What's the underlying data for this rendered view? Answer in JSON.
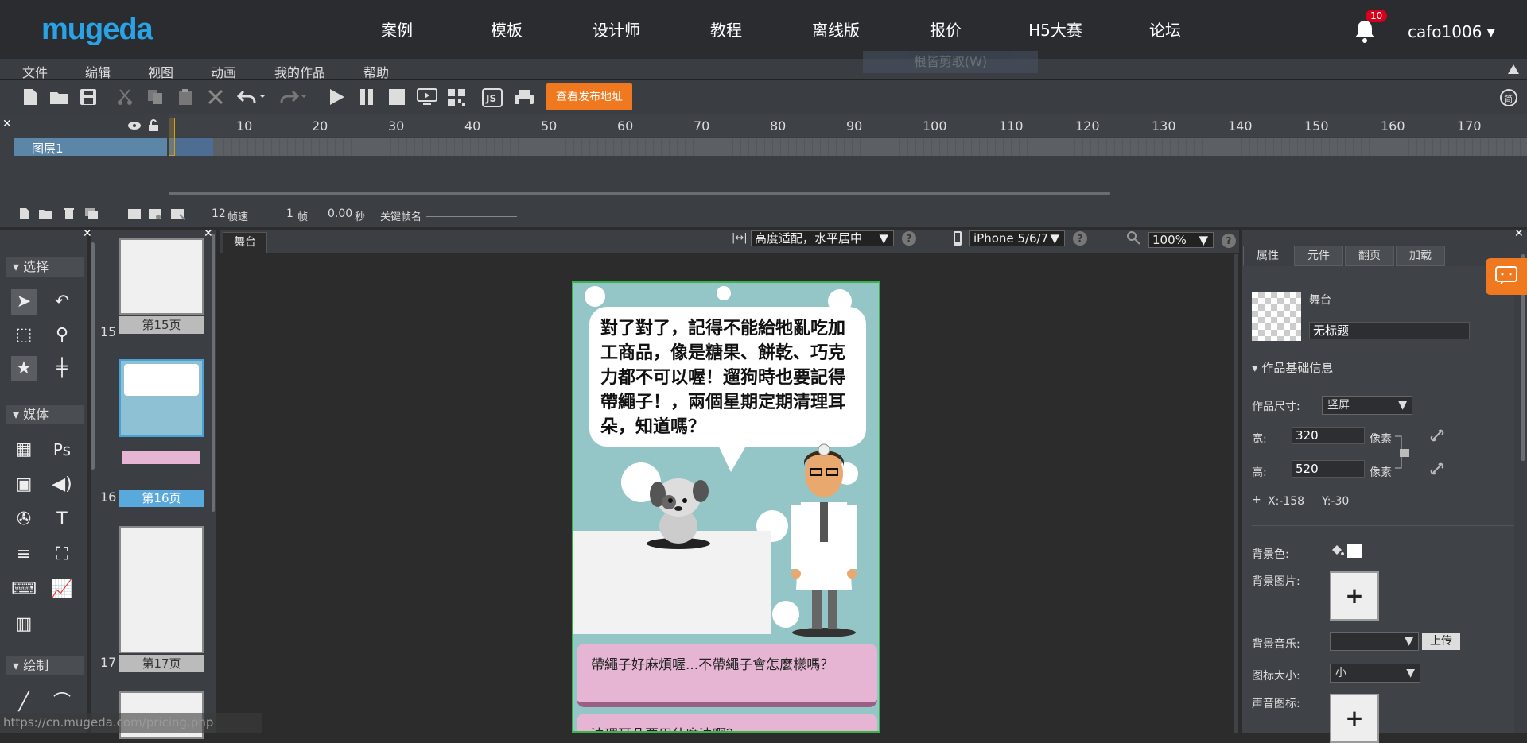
{
  "topnav": {
    "logo": "mugeda",
    "items": [
      "案例",
      "模板",
      "设计师",
      "教程",
      "离线版",
      "报价",
      "H5大赛",
      "论坛"
    ],
    "notification_count": "10",
    "username": "cafo1006 ▾"
  },
  "menubar": {
    "items": [
      "文件",
      "编辑",
      "视图",
      "动画",
      "我的作品",
      "帮助"
    ],
    "ghost_tooltip": "根皆剪取(W)"
  },
  "toolbar": {
    "publish_button": "查看发布地址"
  },
  "timeline": {
    "ruler_ticks": [
      "10",
      "20",
      "30",
      "40",
      "50",
      "60",
      "70",
      "80",
      "90",
      "100",
      "110",
      "120",
      "130",
      "140",
      "150",
      "160",
      "170"
    ],
    "layer_name": "图层1",
    "fps_value": "12",
    "fps_unit": "帧速",
    "frame_value": "1",
    "frame_unit": "帧",
    "time_value": "0.00",
    "time_unit": "秒",
    "keyframe_label": "关键帧名"
  },
  "tools": {
    "sections": [
      "选择",
      "媒体",
      "绘制"
    ]
  },
  "pages": [
    {
      "num": "15",
      "label": "第15页"
    },
    {
      "num": "16",
      "label": "第16页"
    },
    {
      "num": "17",
      "label": "第17页"
    }
  ],
  "stage": {
    "tab": "舞台",
    "fit_mode": "高度适配，水平居中",
    "device": "iPhone 5/6/7",
    "zoom": "100%",
    "bubble_text": "對了對了，記得不能給牠亂吃加工商品，像是糖果、餅乾、巧克力都不可以喔！遛狗時也要記得帶繩子！，兩個星期定期清理耳朵，知道嗎？",
    "choice1": "帶繩子好麻煩喔...不帶繩子會怎麼樣嗎？",
    "choice2": "清理耳朵要用什麼清啊？"
  },
  "properties": {
    "tabs": [
      "属性",
      "元件",
      "翻页",
      "加载"
    ],
    "object_type": "舞台",
    "title_value": "无标题",
    "section_basic": "作品基础信息",
    "size_label": "作品尺寸:",
    "size_value": "竖屏",
    "width_label": "宽:",
    "width_value": "320",
    "height_label": "高:",
    "height_value": "520",
    "unit": "像素",
    "x_label": "X:-158",
    "y_label": "Y:-30",
    "bgcolor_label": "背景色:",
    "bgimage_label": "背景图片:",
    "bgmusic_label": "背景音乐:",
    "upload_button": "上传",
    "iconsize_label": "图标大小:",
    "iconsize_value": "小",
    "soundicon_label": "声音图标:",
    "plus": "+"
  },
  "status_url": "https://cn.mugeda.com/pricing.php",
  "colors": {
    "accent": "#f0781e",
    "logo": "#29a3e6",
    "stage_border": "#3ab34a",
    "layer_selected": "#5b86a8"
  }
}
